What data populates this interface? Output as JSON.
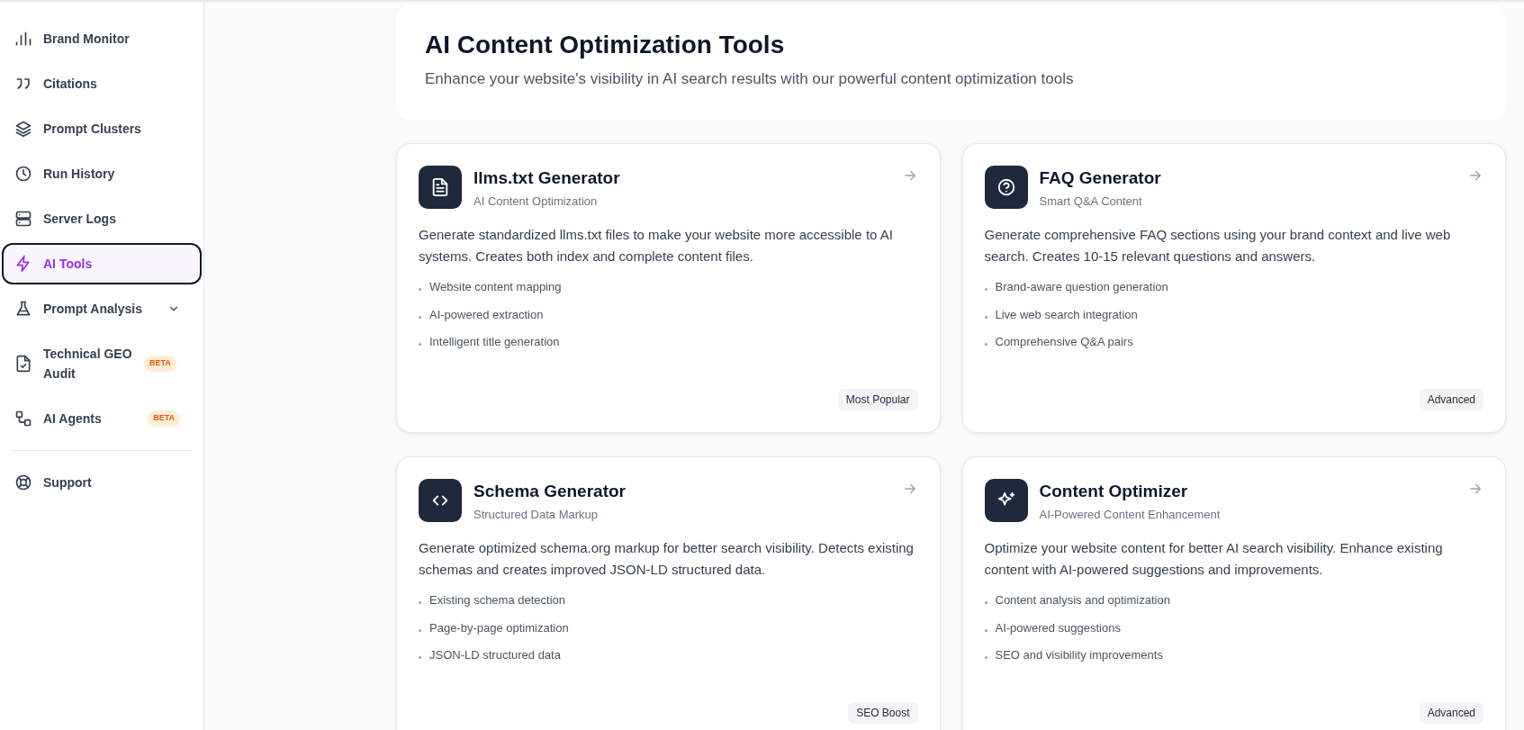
{
  "sidebar": {
    "items": [
      {
        "label": "Brand Monitor",
        "selected": false
      },
      {
        "label": "Citations",
        "selected": false
      },
      {
        "label": "Prompt Clusters",
        "selected": false
      },
      {
        "label": "Run History",
        "selected": false
      },
      {
        "label": "Server Logs",
        "selected": false
      },
      {
        "label": "AI Tools",
        "selected": true
      },
      {
        "label": "Prompt Analysis",
        "selected": false,
        "expanded": false
      },
      {
        "label": "Technical GEO Audit",
        "selected": false,
        "badge": "BETA"
      },
      {
        "label": "AI Agents",
        "selected": false,
        "badge": "BETA"
      }
    ],
    "footer_items": [
      {
        "label": "Support",
        "selected": false
      }
    ]
  },
  "header": {
    "title": "AI Content Optimization Tools",
    "subtitle": "Enhance your website's visibility in AI search results with our powerful content optimization tools"
  },
  "tools": [
    {
      "title": "llms.txt Generator",
      "subtitle": "AI Content Optimization",
      "description": "Generate standardized llms.txt files to make your website more accessible to AI systems. Creates both index and complete content files.",
      "features": [
        "Website content mapping",
        "AI-powered extraction",
        "Intelligent title generation"
      ],
      "badge": "Most Popular"
    },
    {
      "title": "FAQ Generator",
      "subtitle": "Smart Q&A Content",
      "description": "Generate comprehensive FAQ sections using your brand context and live web search. Creates 10-15 relevant questions and answers.",
      "features": [
        "Brand-aware question generation",
        "Live web search integration",
        "Comprehensive Q&A pairs"
      ],
      "badge": "Advanced"
    },
    {
      "title": "Schema Generator",
      "subtitle": "Structured Data Markup",
      "description": "Generate optimized schema.org markup for better search visibility. Detects existing schemas and creates improved JSON-LD structured data.",
      "features": [
        "Existing schema detection",
        "Page-by-page optimization",
        "JSON-LD structured data"
      ],
      "badge": "SEO Boost"
    },
    {
      "title": "Content Optimizer",
      "subtitle": "AI-Powered Content Enhancement",
      "description": "Optimize your website content for better AI search visibility. Enhance existing content with AI-powered suggestions and improvements.",
      "features": [
        "Content analysis and optimization",
        "AI-powered suggestions",
        "SEO and visibility improvements"
      ],
      "badge": "Advanced"
    }
  ]
}
